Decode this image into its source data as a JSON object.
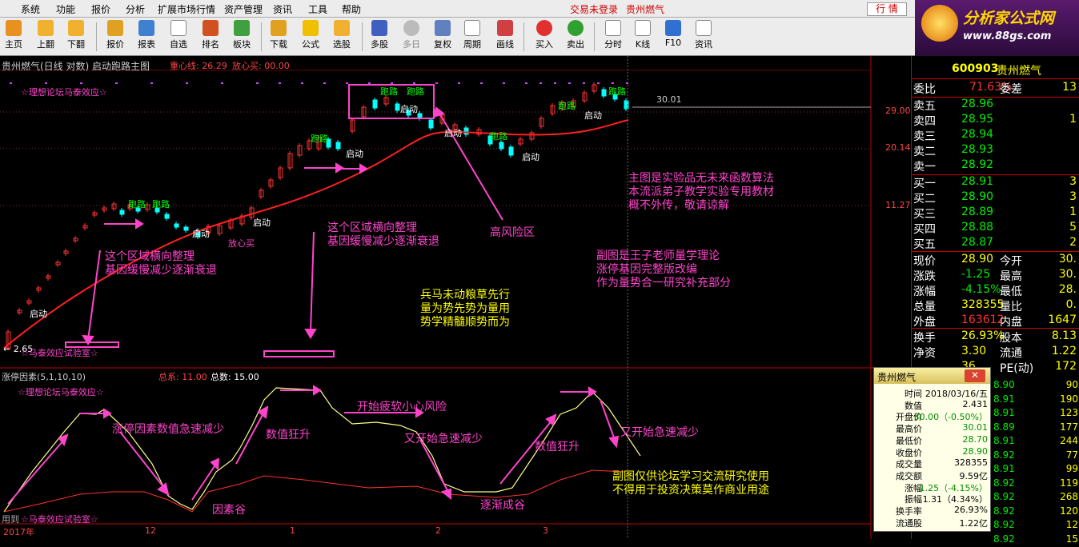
{
  "menu": {
    "items": [
      "系统",
      "功能",
      "报价",
      "分析",
      "扩展市场行情",
      "资产管理",
      "资讯",
      "工具",
      "帮助"
    ],
    "trade_status": "交易未登录",
    "stock_name": "贵州燃气",
    "hq_button": "行 情"
  },
  "toolbar": {
    "buttons": [
      "主页",
      "上翻",
      "下翻",
      "报价",
      "报表",
      "自选",
      "排名",
      "板块",
      "下载",
      "公式",
      "选股",
      "多股",
      "多日",
      "复权",
      "周期",
      "画线",
      "买入",
      "卖出",
      "分时",
      "K线",
      "F10",
      "资讯"
    ]
  },
  "logo": {
    "title": "分析家公式网",
    "url": "www.88gs.com"
  },
  "main_chart": {
    "header": "贵州燃气(日线 对数) 启动跑路主图",
    "center_line": "重心线: 26.29",
    "center_buy": "放心买: 00.00",
    "price_ticks": [
      "29.00",
      "20.14",
      "11.27"
    ],
    "last_label": "30.01",
    "low_label": "← 2.65",
    "start_label": "启动",
    "run_label": "跑路",
    "center_buy_label": "放心买",
    "top_left_label": "☆理想论坛马泰效应☆",
    "bottom_left_label": "☆马泰效应试验室☆",
    "annotations": {
      "zone1_line1": "这个区域横向整理",
      "zone1_line2": "基因缓慢减少逐渐衰退",
      "zone2_line1": "这个区域横向整理",
      "zone2_line2": "基因缓慢减少逐渐衰退",
      "risk": "高风险区",
      "motto1": "兵马未动粮草先行",
      "motto2": "量为势先势为量用",
      "motto3": "势学精髓顺势而为",
      "main_note1": "主图是实验品无未来函数算法",
      "main_note2": "本流派弟子教学实验专用教材",
      "main_note3": "概不外传，敬请谅解",
      "sub_note1": "副图是王子老师量学理论",
      "sub_note2": "涨停基因完整版改编",
      "sub_note3": "作为量势合一研究补充部分"
    }
  },
  "sub_chart": {
    "header": "涨停因素(5,1,10,10)",
    "total_label": "总系: 11.00",
    "total_count": "总数: 15.00",
    "top_left_label": "☆理想论坛马泰效应☆",
    "bottom_left_label": "☆马泰效应试验室☆",
    "bottom_left_prefix": "用到",
    "annotations": {
      "a1": "涨停因素数值急速减少",
      "a2": "数值狂升",
      "a3": "开始疲软小心风险",
      "a4": "又开始急速减少",
      "a5": "数值狂升",
      "a6": "又开始急速减少",
      "a7": "因素谷",
      "a8": "逐渐成谷",
      "note1": "副图仅供论坛学习交流研究使用",
      "note2": "不得用于投资决策莫作商业用途"
    },
    "x_axis": [
      "2017年",
      "12",
      "1",
      "2",
      "3"
    ]
  },
  "side": {
    "code": "600903",
    "name": "贵州燃气",
    "wei_bi_label": "委比",
    "wei_bi": "71.63%",
    "wei_cha_label": "委差",
    "wei_cha": "13",
    "asks": [
      {
        "label": "卖五",
        "price": "28.96",
        "vol": ""
      },
      {
        "label": "卖四",
        "price": "28.95",
        "vol": "1"
      },
      {
        "label": "卖三",
        "price": "28.94",
        "vol": ""
      },
      {
        "label": "卖二",
        "price": "28.93",
        "vol": ""
      },
      {
        "label": "卖一",
        "price": "28.92",
        "vol": ""
      }
    ],
    "bids": [
      {
        "label": "买一",
        "price": "28.91",
        "vol": "3"
      },
      {
        "label": "买二",
        "price": "28.90",
        "vol": "3"
      },
      {
        "label": "买三",
        "price": "28.89",
        "vol": "1"
      },
      {
        "label": "买四",
        "price": "28.88",
        "vol": "5"
      },
      {
        "label": "买五",
        "price": "28.87",
        "vol": "2"
      }
    ],
    "stats": [
      {
        "l1": "现价",
        "v1": "28.90",
        "l2": "今开",
        "v2": "30."
      },
      {
        "l1": "涨跌",
        "v1": "-1.25",
        "l2": "最高",
        "v2": "30."
      },
      {
        "l1": "涨幅",
        "v1": "-4.15%",
        "l2": "最低",
        "v2": "28."
      },
      {
        "l1": "总量",
        "v1": "328355",
        "l2": "量比",
        "v2": "0."
      },
      {
        "l1": "外盘",
        "v1": "163612",
        "l2": "内盘",
        "v2": "1647"
      }
    ],
    "stats2": [
      {
        "l1": "换手",
        "v1": "26.93%",
        "l2": "股本",
        "v2": "8.13"
      },
      {
        "l1": "净资",
        "v1": "3.30",
        "l2": "流通",
        "v2": "1.22"
      },
      {
        "l1": "",
        "v1": "36",
        "l2": "PE(动)",
        "v2": "172"
      }
    ],
    "ticks": [
      {
        "p": "8.90",
        "v": "90"
      },
      {
        "p": "8.91",
        "v": "190"
      },
      {
        "p": "8.91",
        "v": "123"
      },
      {
        "p": "8.89",
        "v": "177"
      },
      {
        "p": "8.91",
        "v": "244"
      },
      {
        "p": "8.92",
        "v": "77"
      },
      {
        "p": "8.91",
        "v": "99"
      },
      {
        "p": "8.92",
        "v": "119"
      },
      {
        "p": "8.92",
        "v": "268"
      },
      {
        "p": "8.92",
        "v": "120"
      },
      {
        "p": "8.92",
        "v": "12"
      },
      {
        "p": "8.92",
        "v": "15"
      }
    ]
  },
  "popup": {
    "title": "贵州燃气",
    "close": "✕",
    "rows": [
      {
        "l": "时间",
        "v": "2018/03/16/五",
        "c": ""
      },
      {
        "l": "数值",
        "v": "2.431",
        "c": ""
      },
      {
        "l": "开盘价",
        "v": "30.00（-0.50%）",
        "c": "green"
      },
      {
        "l": "最高价",
        "v": "30.01",
        "c": "green"
      },
      {
        "l": "最低价",
        "v": "28.70",
        "c": "green"
      },
      {
        "l": "收盘价",
        "v": "28.90",
        "c": "green"
      },
      {
        "l": "成交量",
        "v": "328355",
        "c": ""
      },
      {
        "l": "成交额",
        "v": "9.59亿",
        "c": ""
      },
      {
        "l": "涨幅",
        "v": "-1.25（-4.15%）",
        "c": "green"
      },
      {
        "l": "振幅",
        "v": "1.31（4.34%）",
        "c": ""
      },
      {
        "l": "换手率",
        "v": "26.93%",
        "c": ""
      },
      {
        "l": "流通股",
        "v": "1.22亿",
        "c": ""
      }
    ]
  },
  "colors": {
    "up": "#ff3333",
    "down": "#00ffff",
    "ma": "#ff2020",
    "pink": "#ff44cc",
    "yellow": "#ffff00",
    "green": "#00ee00"
  }
}
